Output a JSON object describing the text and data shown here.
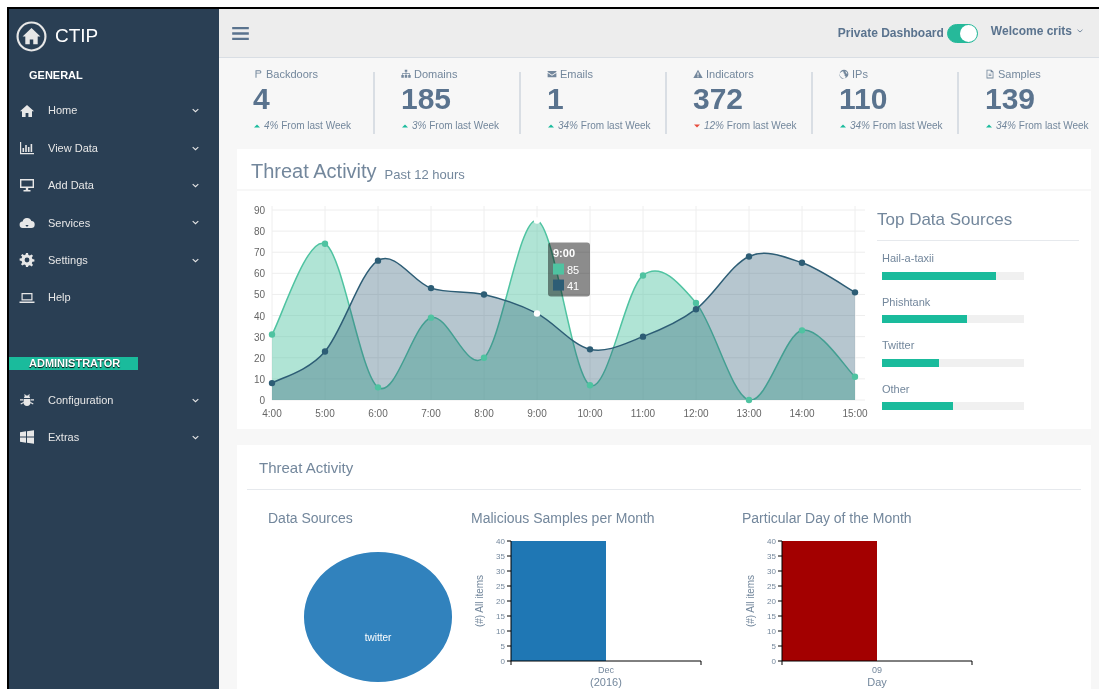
{
  "brand": {
    "title": "CTIP"
  },
  "sidebar": {
    "sections": [
      {
        "kind": "heading",
        "label": "GENERAL",
        "items": [
          {
            "label": "Home",
            "expandable": true
          },
          {
            "label": "View Data",
            "expandable": true
          },
          {
            "label": "Add Data",
            "expandable": true
          },
          {
            "label": "Services",
            "expandable": true
          },
          {
            "label": "Settings",
            "expandable": true
          },
          {
            "label": "Help",
            "expandable": false
          }
        ]
      },
      {
        "kind": "badge",
        "label": "ADMINISTRATOR",
        "items": [
          {
            "label": "Configuration",
            "expandable": true
          },
          {
            "label": "Extras",
            "expandable": true
          }
        ]
      }
    ]
  },
  "header": {
    "private_dashboard": {
      "label": "Private Dashboard",
      "on": true
    },
    "user": {
      "label": "Welcome crits"
    }
  },
  "stats": [
    {
      "label": "Backdoors",
      "value": "4",
      "rising": true,
      "trend": "*4%* From last Week"
    },
    {
      "label": "Domains",
      "value": "185",
      "rising": true,
      "trend": "*3%* From last Week"
    },
    {
      "label": "Emails",
      "value": "1",
      "rising": true,
      "trend": "*34%* From last Week"
    },
    {
      "label": "Indicators",
      "value": "372",
      "rising": false,
      "trend": "*12%* From last Week"
    },
    {
      "label": "IPs",
      "value": "110",
      "rising": true,
      "trend": "*34%* From last Week"
    },
    {
      "label": "Samples",
      "value": "139",
      "rising": true,
      "trend": "*34%* From last Week"
    }
  ],
  "threat_activity": {
    "title": "Threat Activity",
    "subtitle": "Past 12 hours",
    "chart_data": {
      "type": "area",
      "grid": true,
      "x": [
        "4:00",
        "5:00",
        "6:00",
        "7:00",
        "8:00",
        "9:00",
        "10:00",
        "11:00",
        "12:00",
        "13:00",
        "14:00",
        "15:00"
      ],
      "ylim": [
        0,
        90
      ],
      "yticks": [
        0,
        10,
        20,
        30,
        40,
        50,
        60,
        70,
        80,
        90
      ],
      "series": [
        {
          "color": "#4fc3a1",
          "values": [
            31,
            74,
            6,
            39,
            20,
            85,
            7,
            59,
            46,
            0,
            33,
            11
          ]
        },
        {
          "color": "#2d5d75",
          "values": [
            8,
            23,
            66,
            53,
            50,
            41,
            24,
            30,
            43,
            68,
            65,
            51
          ]
        }
      ]
    },
    "tooltip": {
      "title": "9:00",
      "entries": [
        "85",
        "41"
      ]
    }
  },
  "top_sources": {
    "title": "Top Data Sources",
    "items": [
      {
        "label": "Hail-a-taxii",
        "level": 0.8
      },
      {
        "label": "Phishtank",
        "level": 0.6
      },
      {
        "label": "Twitter",
        "level": 0.4
      },
      {
        "label": "Other",
        "level": 0.5
      }
    ]
  },
  "summary": {
    "title": "Threat Activity",
    "charts": [
      {
        "title": "Data Sources",
        "chart_data": {
          "type": "pie",
          "categories": [
            "twitter"
          ],
          "series": [
            {
              "color": "#3182bd",
              "values": [
                100
              ]
            }
          ]
        }
      },
      {
        "title": "Malicious Samples per Month",
        "chart_data": {
          "type": "bar",
          "categories": [
            "Dec"
          ],
          "xlabel": "(2016)",
          "ylabel": "(#) All items",
          "ylim": [
            0,
            40
          ],
          "yticks": [
            0,
            5,
            10,
            15,
            20,
            25,
            30,
            35,
            40
          ],
          "series": [
            {
              "color": "#1f77b4",
              "values": [
                40
              ]
            }
          ]
        }
      },
      {
        "title": "Particular Day of the Month",
        "chart_data": {
          "type": "bar",
          "categories": [
            "09"
          ],
          "xlabel": "Day",
          "ylabel": "(#) All items",
          "ylim": [
            0,
            40
          ],
          "yticks": [
            0,
            5,
            10,
            15,
            20,
            25,
            30,
            35,
            40
          ],
          "series": [
            {
              "color": "#a30000",
              "values": [
                40
              ]
            }
          ]
        }
      }
    ]
  }
}
